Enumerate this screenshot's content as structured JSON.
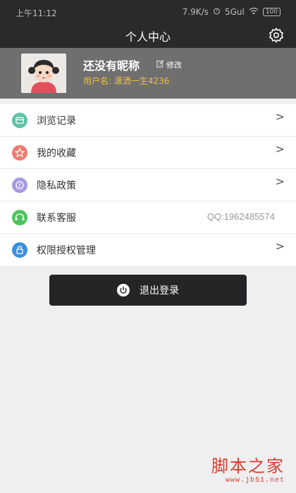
{
  "status_bar": {
    "time": "上午11:12",
    "network_speed": "7.9K/s",
    "signal_text": "5Gul",
    "battery": "100"
  },
  "header": {
    "title": "个人中心",
    "settings_icon": "gear-icon"
  },
  "profile": {
    "nickname": "还没有昵称",
    "edit_label": "修改",
    "username_label": "用户名:",
    "username_value": "潇洒一生4236",
    "colors": {
      "background": "#6f6f70",
      "username": "#f0c040"
    }
  },
  "menu": [
    {
      "label": "浏览记录",
      "icon": "history-icon",
      "icon_color": "#5fc3a8",
      "has_chevron": true
    },
    {
      "label": "我的收藏",
      "icon": "star-icon",
      "icon_color": "#f07a70",
      "has_chevron": true
    },
    {
      "label": "隐私政策",
      "icon": "privacy-icon",
      "icon_color": "#a79ae0",
      "has_chevron": true
    },
    {
      "label": "联系客服",
      "icon": "service-icon",
      "icon_color": "#4cc45c",
      "value": "QQ:1962485574",
      "has_chevron": false
    },
    {
      "label": "权限授权管理",
      "icon": "lock-icon",
      "icon_color": "#3b8fe0",
      "has_chevron": true
    }
  ],
  "chevron_glyph": ">",
  "logout": {
    "label": "退出登录",
    "icon": "power-icon"
  },
  "watermark": {
    "title": "脚本之家",
    "url": "www.jb51.net"
  }
}
